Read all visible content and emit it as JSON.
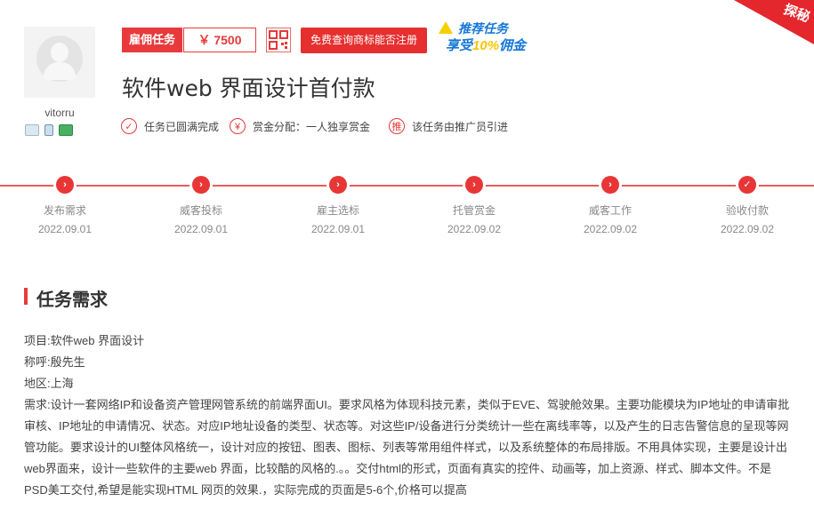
{
  "employer": {
    "username": "vitorru"
  },
  "task": {
    "type_tag": "雇佣任务",
    "price": "￥ 7500",
    "free_check_button": "免费查询商标能否注册",
    "promo_line1": "推荐任务",
    "promo_line2_pre": "享受",
    "promo_line2_hl": "10%",
    "promo_line2_post": "佣金",
    "title": "软件web 界面设计首付款",
    "status_items": [
      {
        "icon": "✓",
        "label": "任务已圆满完成"
      },
      {
        "icon": "¥",
        "label": "赏金分配：一人独享赏金"
      },
      {
        "icon": "推",
        "label": "该任务由推广员引进"
      }
    ]
  },
  "corner_ribbon": "探秘",
  "timeline": [
    {
      "label": "发布需求",
      "date": "2022.09.01",
      "icon": "›"
    },
    {
      "label": "威客投标",
      "date": "2022.09.01",
      "icon": "›"
    },
    {
      "label": "雇主选标",
      "date": "2022.09.01",
      "icon": "›"
    },
    {
      "label": "托管赏金",
      "date": "2022.09.02",
      "icon": "›"
    },
    {
      "label": "威客工作",
      "date": "2022.09.02",
      "icon": "›"
    },
    {
      "label": "验收付款",
      "date": "2022.09.02",
      "icon": "✓"
    }
  ],
  "requirements": {
    "heading": "任务需求",
    "project": "项目:软件web 界面设计",
    "contact": "称呼:殷先生",
    "region": "地区:上海",
    "description": "需求:设计一套网络IP和设备资产管理网管系统的前端界面UI。要求风格为体现科技元素，类似于EVE、驾驶舱效果。主要功能模块为IP地址的申请审批审核、IP地址的申请情况、状态。对应IP地址设备的类型、状态等。对这些IP/设备进行分类统计一些在离线率等，以及产生的日志告警信息的呈现等网管功能。要求设计的UI整体风格统一，设计对应的按钮、图表、图标、列表等常用组件样式，以及系统整体的布局排版。不用具体实现，主要是设计出web界面来，设计一些软件的主要web 界面，比较酷的风格的.。。交付html的形式，页面有真实的控件、动画等，加上资源、样式、脚本文件。不是PSD美工交付,希望是能实现HTML 网页的效果.，实际完成的页面是5-6个,价格可以提高"
  }
}
